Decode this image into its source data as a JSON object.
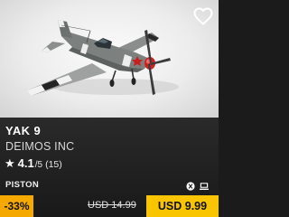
{
  "product": {
    "title": "YAK 9",
    "publisher": "DEIMOS INC",
    "image_alt": "Yak-9 fighter aircraft model"
  },
  "rating": {
    "icon": "star-icon",
    "score": "4.1",
    "scale": "/5",
    "count": "(15)"
  },
  "engine": "PISTON",
  "platforms": [
    "windows-icon",
    "mac-icon"
  ],
  "price": {
    "discount": "-33%",
    "original": "USD 14.99",
    "current": "USD 9.99"
  },
  "colors": {
    "discount_bg": "#f5a800",
    "price_bg": "#f9c400",
    "card_bg": "#1e1e1e"
  }
}
